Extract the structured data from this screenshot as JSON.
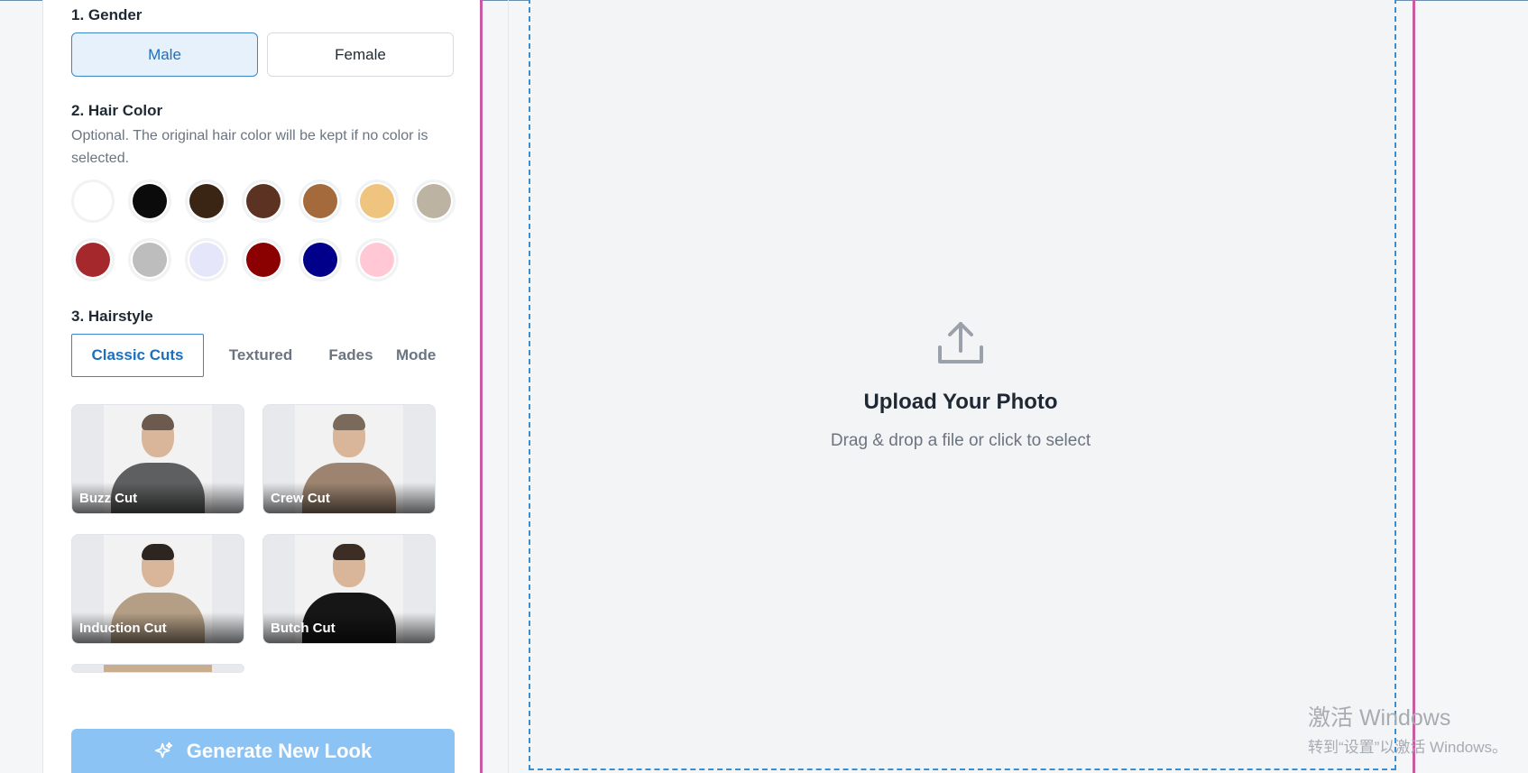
{
  "gender": {
    "title": "1. Gender",
    "options": [
      "Male",
      "Female"
    ],
    "selected": "Male"
  },
  "hair_color": {
    "title": "2. Hair Color",
    "description": "Optional. The original hair color will be kept if no color is selected.",
    "swatches": [
      "#ffffff",
      "#0b0b0b",
      "#3a2414",
      "#5c3322",
      "#a46a3c",
      "#efc47f",
      "#bdb3a2",
      "#a5282c",
      "#bdbdbd",
      "#e6e6fa",
      "#8b0000",
      "#00008b",
      "#ffc8d4"
    ]
  },
  "hairstyle": {
    "title": "3. Hairstyle",
    "tabs": [
      "Classic Cuts",
      "Textured",
      "Fades",
      "Mode"
    ],
    "active_tab": "Classic Cuts",
    "cards": [
      {
        "label": "Buzz Cut",
        "shirt": "#5e5f60",
        "hair": "#6b5a4d"
      },
      {
        "label": "Crew Cut",
        "shirt": "#9c8470",
        "hair": "#7a6a5c"
      },
      {
        "label": "Induction Cut",
        "shirt": "#b49e86",
        "hair": "#2d2520"
      },
      {
        "label": "Butch Cut",
        "shirt": "#161616",
        "hair": "#3d2e25"
      }
    ]
  },
  "generate_button": {
    "label": "Generate New Look",
    "icon": "sparkle-icon"
  },
  "upload": {
    "title": "Upload Your Photo",
    "subtitle": "Drag & drop a file or click to select",
    "icon": "upload-icon"
  },
  "watermark": {
    "line1": "激活 Windows",
    "line2": "转到“设置”以激活 Windows。"
  }
}
